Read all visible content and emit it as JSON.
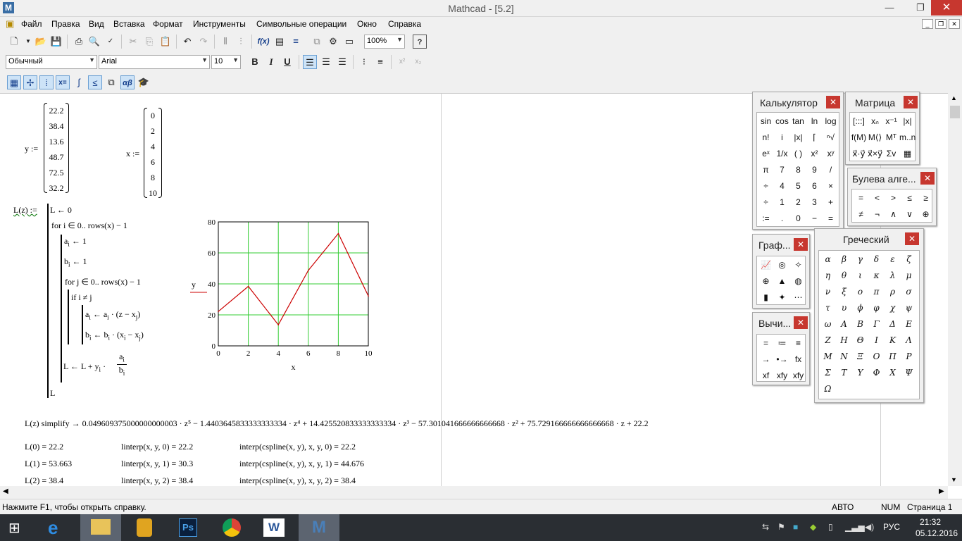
{
  "window": {
    "title": "Mathcad - [5.2]"
  },
  "menu": [
    "Файл",
    "Правка",
    "Вид",
    "Вставка",
    "Формат",
    "Инструменты",
    "Символьные операции",
    "Окно",
    "Справка"
  ],
  "toolbar": {
    "zoom": "100%",
    "style": "Обычный",
    "font": "Arial",
    "size": "10",
    "bold": "B",
    "italic": "I",
    "underline": "U"
  },
  "worksheet": {
    "y_label": "y :=",
    "y_values": [
      "22.2",
      "38.4",
      "13.6",
      "48.7",
      "72.5",
      "32.2"
    ],
    "x_label": "x :=",
    "x_values": [
      "0",
      "2",
      "4",
      "6",
      "8",
      "10"
    ],
    "func_def": "L(z) :=",
    "program": [
      "L ← 0",
      "for  i ∈ 0.. rows(x) − 1",
      "a",
      "← 1",
      "b",
      "← 1",
      "for  j ∈ 0.. rows(x) − 1",
      "if  i ≠ j",
      "L ← L + y",
      "L"
    ],
    "simplify": "L(z) simplify  → 0.049609375000000000003 · z⁵ − 1.4403645833333333334 · z⁴ + 14.425520833333333334 · z³ − 57.301041666666666668 · z² + 75.729166666666666668 · z + 22.2",
    "results": [
      [
        "L(0) = 22.2",
        "linterp(x, y, 0) = 22.2",
        "interp(cspline(x, y), x, y, 0) = 22.2"
      ],
      [
        "L(1) = 53.663",
        "linterp(x, y, 1) = 30.3",
        "interp(cspline(x, y), x, y, 1) = 44.676"
      ],
      [
        "L(2) = 38.4",
        "linterp(x, y, 2) = 38.4",
        "interp(cspline(x, y), x, y, 2) = 38.4"
      ]
    ]
  },
  "chart_data": {
    "type": "line",
    "x": [
      0,
      2,
      4,
      6,
      8,
      10
    ],
    "series": [
      {
        "values": [
          22.2,
          38.4,
          13.6,
          48.7,
          72.5,
          32.2
        ],
        "color": "#cc0000"
      }
    ],
    "xlabel": "x",
    "ylabel": "y",
    "xlim": [
      0,
      10
    ],
    "ylim": [
      0,
      80
    ],
    "xticks": [
      "0",
      "2",
      "4",
      "6",
      "8",
      "10"
    ],
    "yticks": [
      "0",
      "20",
      "40",
      "60",
      "80"
    ],
    "grid": true,
    "grid_color": "#33cc33"
  },
  "panels": {
    "calculator": {
      "title": "Калькулятор",
      "buttons": [
        "sin",
        "cos",
        "tan",
        "ln",
        "log",
        "n!",
        "i",
        "|x|",
        "⌈",
        "ⁿ√",
        "eˣ",
        "1/x",
        "( )",
        "x²",
        "xʸ",
        "π",
        "7",
        "8",
        "9",
        "/",
        "÷",
        "4",
        "5",
        "6",
        "×",
        "÷",
        "1",
        "2",
        "3",
        "+",
        ":=",
        ".",
        "0",
        "−",
        "="
      ]
    },
    "matrix": {
      "title": "Матрица",
      "buttons": [
        "[:::]",
        "xₙ",
        "x⁻¹",
        "|x|",
        "f(M)",
        "M⟨⟩",
        "Mᵀ",
        "m..n",
        "x⃗·y⃗",
        "x⃗×y⃗",
        "Σv",
        "▦"
      ]
    },
    "boolean": {
      "title": "Булева алге...",
      "buttons": [
        "=",
        "<",
        ">",
        "≤",
        "≥",
        "≠",
        "¬",
        "∧",
        "∨",
        "⊕"
      ]
    },
    "graph": {
      "title": "Граф...",
      "buttons": [
        "📈",
        "◎",
        "✧",
        "⊕",
        "▲",
        "◍",
        "▮",
        "✦",
        "⋯"
      ]
    },
    "evaluation": {
      "title": "Вычи...",
      "buttons": [
        "=",
        "≔",
        "≡",
        "→",
        "•→",
        "fx",
        "xf",
        "xfy",
        "xfy"
      ]
    },
    "greek": {
      "title": "Греческий",
      "buttons": [
        "α",
        "β",
        "γ",
        "δ",
        "ε",
        "ζ",
        "η",
        "θ",
        "ι",
        "κ",
        "λ",
        "μ",
        "ν",
        "ξ",
        "ο",
        "π",
        "ρ",
        "σ",
        "τ",
        "υ",
        "ϕ",
        "φ",
        "χ",
        "ψ",
        "ω",
        "Α",
        "Β",
        "Γ",
        "Δ",
        "Ε",
        "Ζ",
        "Η",
        "Θ",
        "Ι",
        "Κ",
        "Λ",
        "Μ",
        "Ν",
        "Ξ",
        "Ο",
        "Π",
        "Ρ",
        "Σ",
        "Τ",
        "Υ",
        "Φ",
        "Χ",
        "Ψ",
        "Ω"
      ]
    }
  },
  "status": {
    "hint": "Нажмите F1, чтобы открыть справку.",
    "mode": "АВТО",
    "num": "NUM",
    "page": "Страница 1"
  },
  "taskbar": {
    "lang": "РУС",
    "time": "21:32",
    "date": "05.12.2016"
  }
}
